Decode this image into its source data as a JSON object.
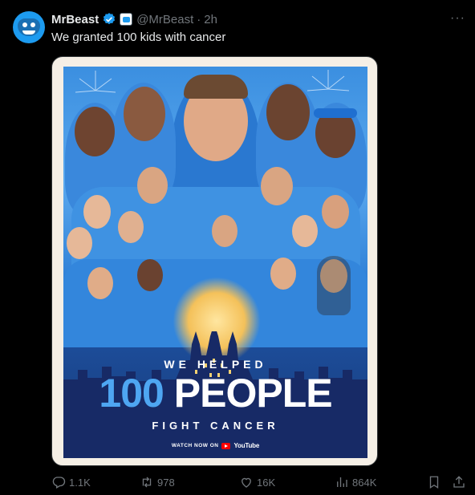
{
  "tweet": {
    "display_name": "MrBeast",
    "handle": "@MrBeast",
    "separator": "·",
    "time": "2h",
    "more": "···",
    "text": "We granted 100 kids with cancer"
  },
  "poster": {
    "line1": "WE HELPED",
    "line2_number": "100",
    "line2_word": "PEOPLE",
    "line3": "FIGHT CANCER",
    "watch_text": "WATCH NOW ON",
    "youtube_word": "YouTube"
  },
  "actions": {
    "replies": "1.1K",
    "reposts": "978",
    "likes": "16K",
    "views": "864K"
  },
  "colors": {
    "background": "#000000",
    "text": "#e7e9ea",
    "muted": "#71767b",
    "verified": "#1d9bf0",
    "poster_accent": "#4ea6f2"
  },
  "icons": [
    "verified-badge-icon",
    "affiliate-badge-icon",
    "more-icon",
    "reply-icon",
    "repost-icon",
    "like-icon",
    "views-icon",
    "bookmark-icon",
    "share-icon"
  ]
}
